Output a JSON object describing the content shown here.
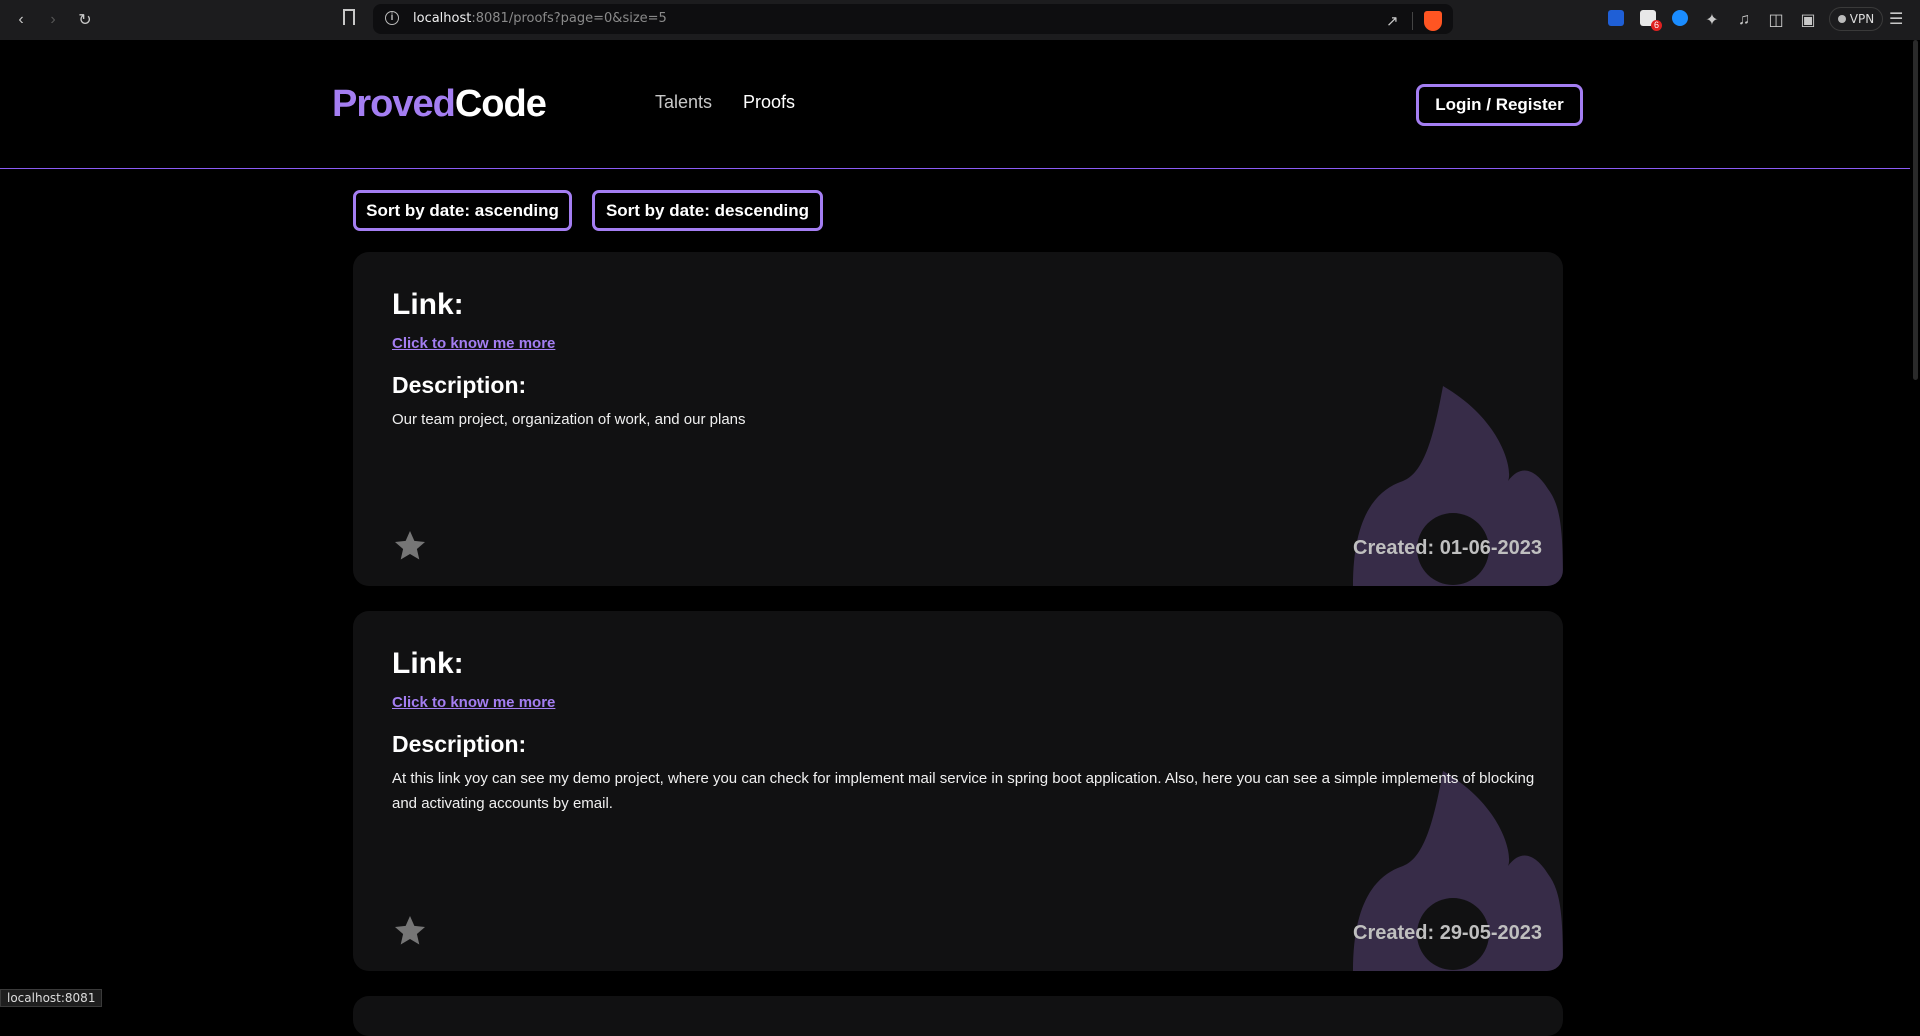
{
  "browser": {
    "url_host": "localhost",
    "url_rest": ":8081/proofs?page=0&size=5",
    "vpn_label": "VPN",
    "mail_badge": "6",
    "status_url": "localhost:8081"
  },
  "header": {
    "logo_part1": "Proved",
    "logo_part2": "Code",
    "nav": {
      "talents": "Talents",
      "proofs": "Proofs"
    },
    "login_label": "Login / Register",
    "accent_color": "#a47ef2"
  },
  "sort": {
    "ascending_label": "Sort by date: ascending",
    "descending_label": "Sort by date: descending"
  },
  "proofs": [
    {
      "link_heading": "Link:",
      "link_text": "Click to know me more",
      "description_heading": "Description:",
      "description": "Our team project, organization of work, and our plans",
      "created": "Created: 01-06-2023",
      "icon": "star-icon"
    },
    {
      "link_heading": "Link:",
      "link_text": "Click to know me more",
      "description_heading": "Description:",
      "description": "At this link yoy can see my demo project, where you can check for implement mail service in spring boot application. Also, here you can see a simple implements of blocking and activating accounts by email.",
      "created": "Created: 29-05-2023",
      "icon": "star-icon"
    }
  ]
}
